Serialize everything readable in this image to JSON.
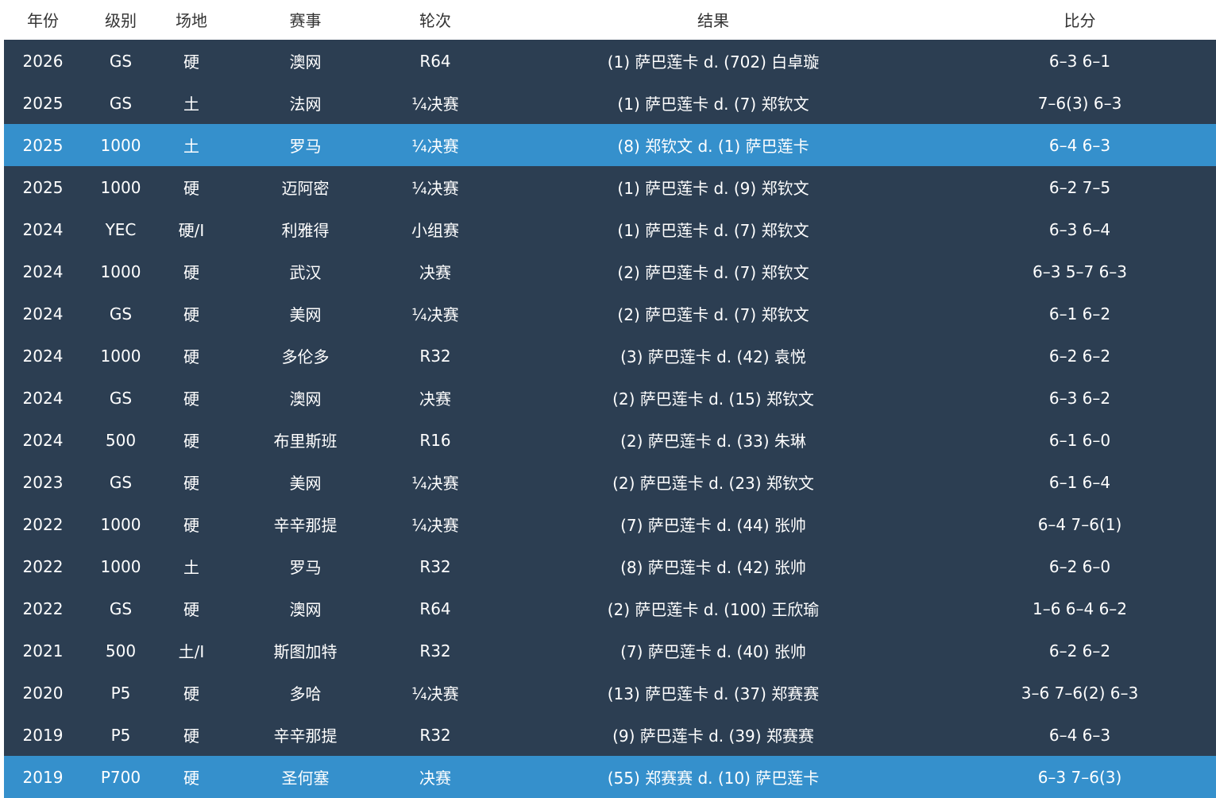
{
  "colors": {
    "header_bg": "#ffffff",
    "header_text": "#333333",
    "row_bg": "#2c3e52",
    "row_highlight_bg": "#3590cc",
    "row_text": "#ffffff"
  },
  "headers": [
    "年份",
    "级别",
    "场地",
    "赛事",
    "轮次",
    "结果",
    "比分"
  ],
  "rows": [
    {
      "year": "2026",
      "level": "GS",
      "surface": "硬",
      "event": "澳网",
      "round": "R64",
      "result": "(1) 萨巴莲卡 d. (702) 白卓璇",
      "score": "6–3 6–1",
      "highlight": false
    },
    {
      "year": "2025",
      "level": "GS",
      "surface": "土",
      "event": "法网",
      "round": "¼决赛",
      "result": "(1) 萨巴莲卡 d. (7) 郑钦文",
      "score": "7–6(3) 6–3",
      "highlight": false
    },
    {
      "year": "2025",
      "level": "1000",
      "surface": "土",
      "event": "罗马",
      "round": "¼决赛",
      "result": "(8) 郑钦文 d. (1) 萨巴莲卡",
      "score": "6–4 6–3",
      "highlight": true
    },
    {
      "year": "2025",
      "level": "1000",
      "surface": "硬",
      "event": "迈阿密",
      "round": "¼决赛",
      "result": "(1) 萨巴莲卡 d. (9) 郑钦文",
      "score": "6–2 7–5",
      "highlight": false
    },
    {
      "year": "2024",
      "level": "YEC",
      "surface": "硬/I",
      "event": "利雅得",
      "round": "小组赛",
      "result": "(1) 萨巴莲卡 d. (7) 郑钦文",
      "score": "6–3 6–4",
      "highlight": false
    },
    {
      "year": "2024",
      "level": "1000",
      "surface": "硬",
      "event": "武汉",
      "round": "决赛",
      "result": "(2) 萨巴莲卡 d. (7) 郑钦文",
      "score": "6–3 5–7 6–3",
      "highlight": false
    },
    {
      "year": "2024",
      "level": "GS",
      "surface": "硬",
      "event": "美网",
      "round": "¼决赛",
      "result": "(2) 萨巴莲卡 d. (7) 郑钦文",
      "score": "6–1 6–2",
      "highlight": false
    },
    {
      "year": "2024",
      "level": "1000",
      "surface": "硬",
      "event": "多伦多",
      "round": "R32",
      "result": "(3) 萨巴莲卡 d. (42) 袁悦",
      "score": "6–2 6–2",
      "highlight": false
    },
    {
      "year": "2024",
      "level": "GS",
      "surface": "硬",
      "event": "澳网",
      "round": "决赛",
      "result": "(2) 萨巴莲卡 d. (15) 郑钦文",
      "score": "6–3 6–2",
      "highlight": false
    },
    {
      "year": "2024",
      "level": "500",
      "surface": "硬",
      "event": "布里斯班",
      "round": "R16",
      "result": "(2) 萨巴莲卡 d. (33) 朱琳",
      "score": "6–1 6–0",
      "highlight": false
    },
    {
      "year": "2023",
      "level": "GS",
      "surface": "硬",
      "event": "美网",
      "round": "¼决赛",
      "result": "(2) 萨巴莲卡 d. (23) 郑钦文",
      "score": "6–1 6–4",
      "highlight": false
    },
    {
      "year": "2022",
      "level": "1000",
      "surface": "硬",
      "event": "辛辛那提",
      "round": "¼决赛",
      "result": "(7) 萨巴莲卡 d. (44) 张帅",
      "score": "6–4 7–6(1)",
      "highlight": false
    },
    {
      "year": "2022",
      "level": "1000",
      "surface": "土",
      "event": "罗马",
      "round": "R32",
      "result": "(8) 萨巴莲卡 d. (42) 张帅",
      "score": "6–2 6–0",
      "highlight": false
    },
    {
      "year": "2022",
      "level": "GS",
      "surface": "硬",
      "event": "澳网",
      "round": "R64",
      "result": "(2) 萨巴莲卡 d. (100) 王欣瑜",
      "score": "1–6 6–4 6–2",
      "highlight": false
    },
    {
      "year": "2021",
      "level": "500",
      "surface": "土/I",
      "event": "斯图加特",
      "round": "R32",
      "result": "(7) 萨巴莲卡 d. (40) 张帅",
      "score": "6–2 6–2",
      "highlight": false
    },
    {
      "year": "2020",
      "level": "P5",
      "surface": "硬",
      "event": "多哈",
      "round": "¼决赛",
      "result": "(13) 萨巴莲卡 d. (37) 郑赛赛",
      "score": "3–6 7–6(2) 6–3",
      "highlight": false
    },
    {
      "year": "2019",
      "level": "P5",
      "surface": "硬",
      "event": "辛辛那提",
      "round": "R32",
      "result": "(9) 萨巴莲卡 d. (39) 郑赛赛",
      "score": "6–4 6–3",
      "highlight": false
    },
    {
      "year": "2019",
      "level": "P700",
      "surface": "硬",
      "event": "圣何塞",
      "round": "决赛",
      "result": "(55) 郑赛赛 d. (10) 萨巴莲卡",
      "score": "6–3 7–6(3)",
      "highlight": true
    }
  ]
}
